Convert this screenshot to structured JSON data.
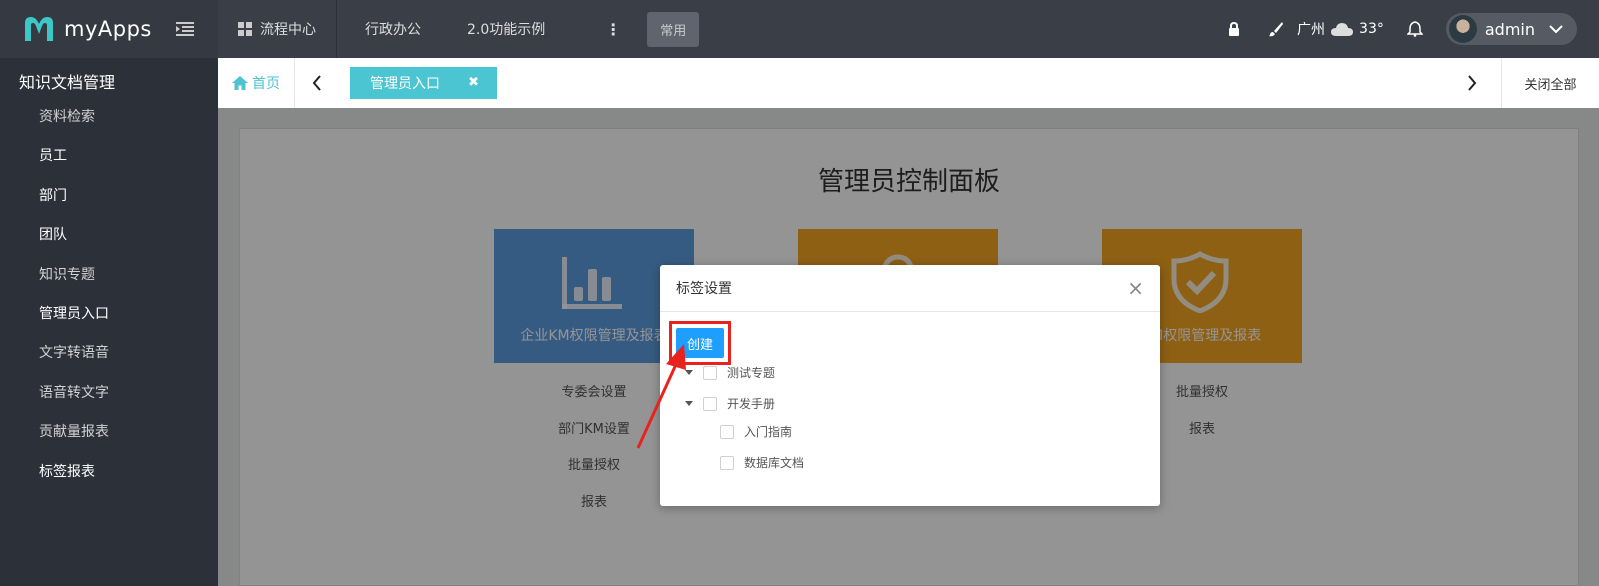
{
  "app": {
    "name": "myApps"
  },
  "nav": {
    "items": [
      "流程中心",
      "行政办公",
      "2.0功能示例"
    ],
    "more": "⋮",
    "common": "常用"
  },
  "header": {
    "city": "广州",
    "temp": "33°",
    "user": "admin"
  },
  "sidebar": {
    "title": "知识文档管理",
    "items": [
      {
        "label": "资料检索"
      },
      {
        "label": "员工"
      },
      {
        "label": "部门"
      },
      {
        "label": "团队"
      },
      {
        "label": "知识专题"
      },
      {
        "label": "管理员入口"
      },
      {
        "label": "文字转语音"
      },
      {
        "label": "语音转文字"
      },
      {
        "label": "贡献量报表"
      },
      {
        "label": "标签报表"
      }
    ]
  },
  "tabs": {
    "home": "首页",
    "active": "管理员入口",
    "close_all": "关闭全部"
  },
  "panel": {
    "title": "管理员控制面板",
    "cards": [
      {
        "label": "企业KM权限管理及报表",
        "links": [
          "专委会设置",
          "部门KM设置",
          "批量授权",
          "报表"
        ]
      },
      {
        "label": "",
        "links": []
      },
      {
        "label": "KM权限管理及报表",
        "links": [
          "批量授权",
          "报表"
        ]
      }
    ]
  },
  "modal": {
    "title": "标签设置",
    "create": "创建",
    "tree": [
      {
        "label": "测试专题"
      },
      {
        "label": "开发手册",
        "children": [
          {
            "label": "入门指南"
          },
          {
            "label": "数据库文档"
          }
        ]
      }
    ]
  },
  "colors": {
    "accent": "#4cc5d2",
    "primary_button": "#1e9fff",
    "highlight": "#e8231f",
    "card_blue": "#5d9ee1",
    "card_orange": "#f5a623"
  }
}
